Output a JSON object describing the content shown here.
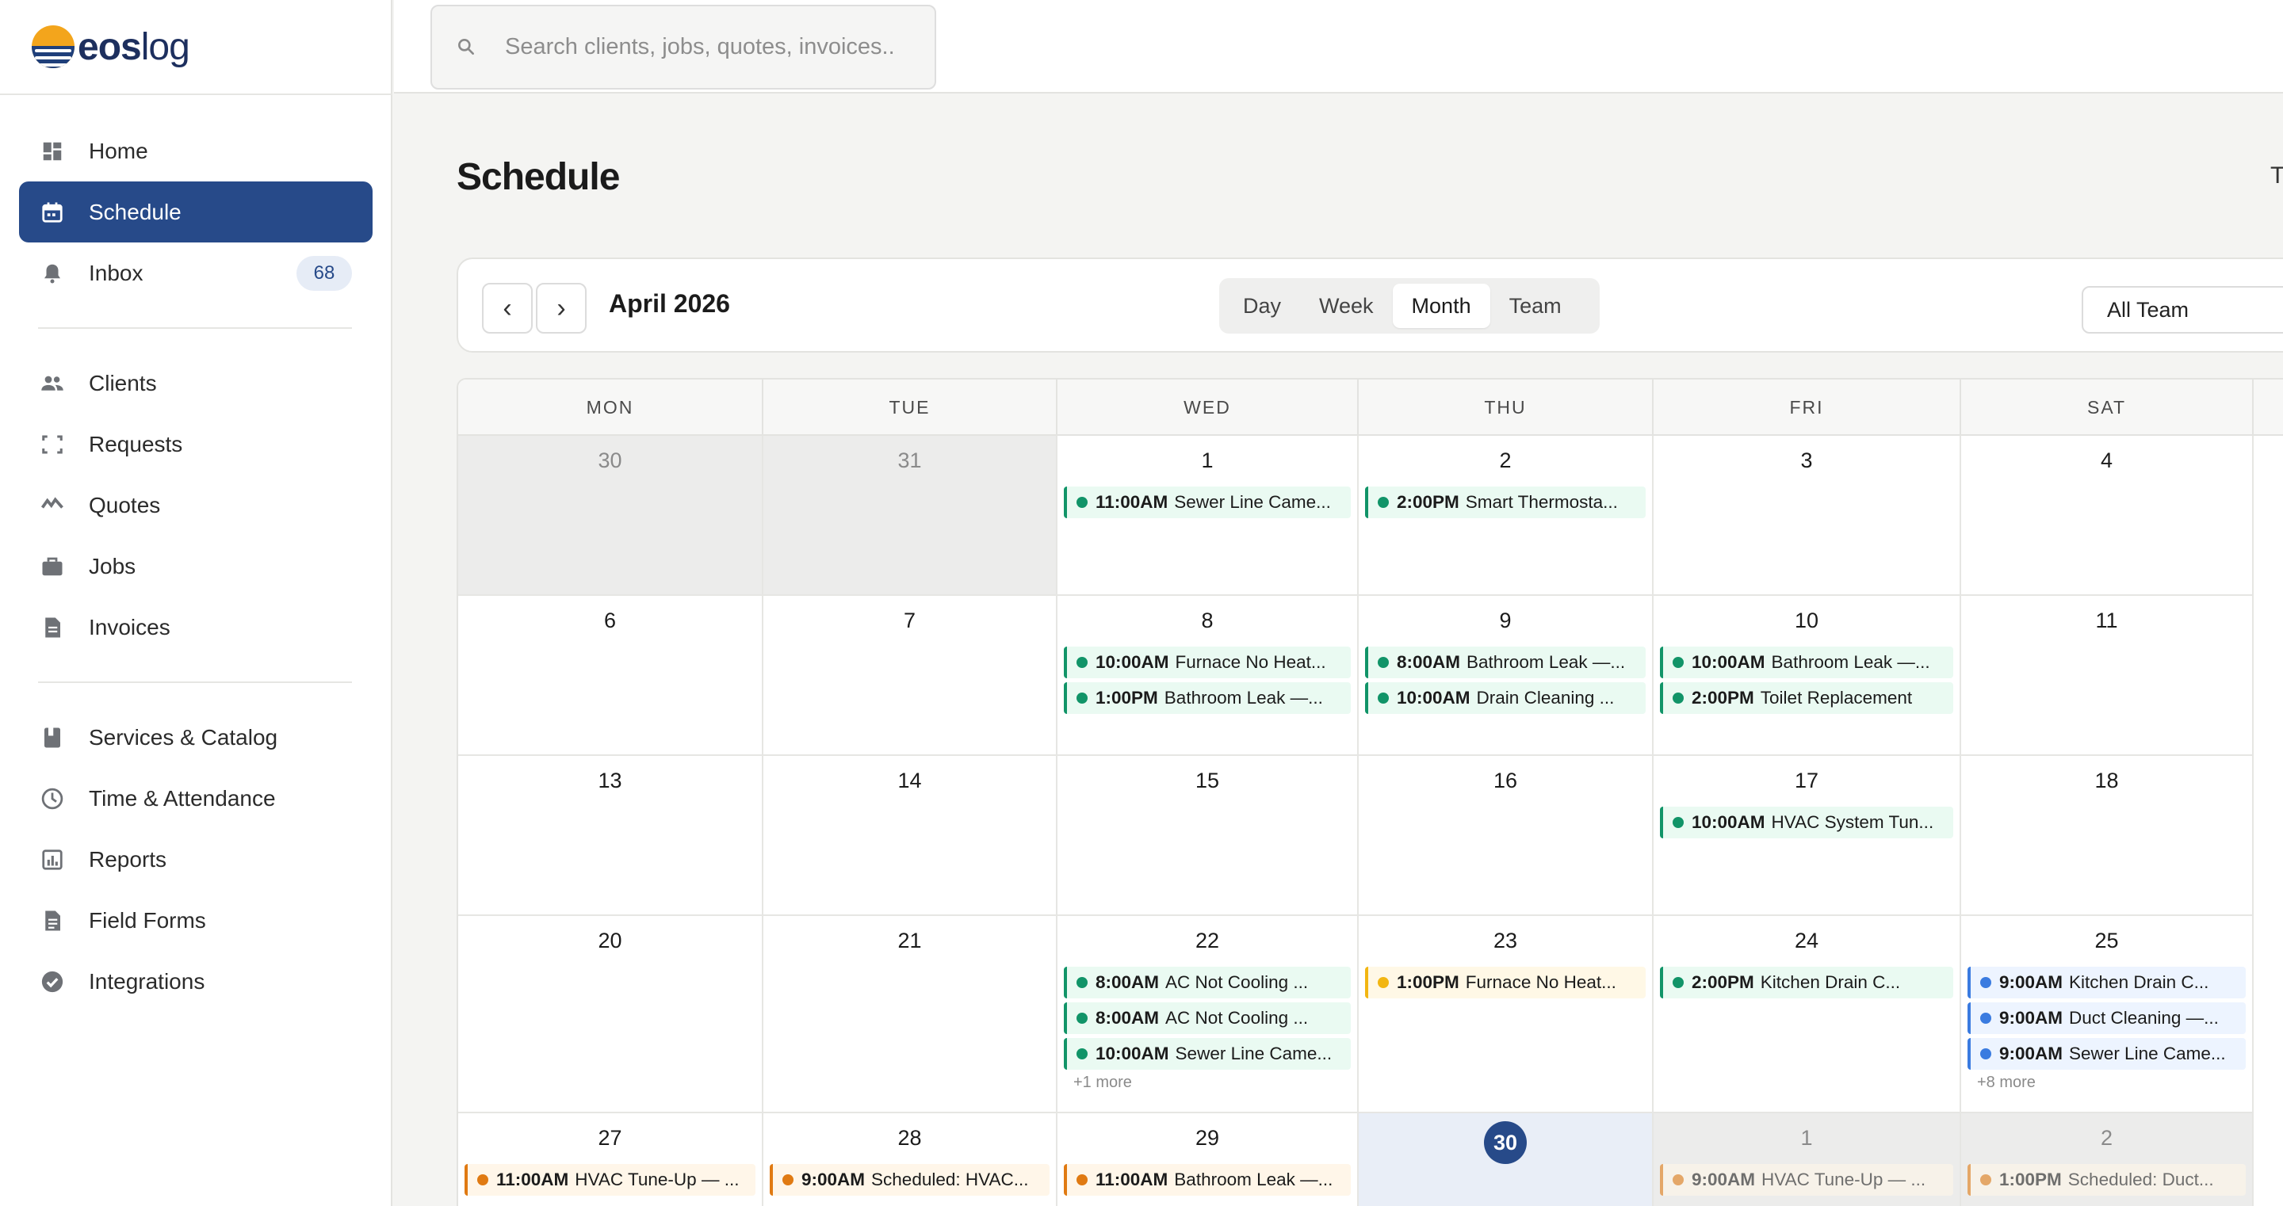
{
  "brand": {
    "name": "eoslog"
  },
  "search": {
    "placeholder": "Search clients, jobs, quotes, invoices.."
  },
  "sidebar": {
    "group1": [
      {
        "label": "Home",
        "icon": "dashboard-icon",
        "active": false
      },
      {
        "label": "Schedule",
        "icon": "calendar-icon",
        "active": true
      },
      {
        "label": "Inbox",
        "icon": "bell-icon",
        "active": false,
        "badge": "68"
      }
    ],
    "group2": [
      {
        "label": "Clients",
        "icon": "people-icon"
      },
      {
        "label": "Requests",
        "icon": "request-icon"
      },
      {
        "label": "Quotes",
        "icon": "quotes-icon"
      },
      {
        "label": "Jobs",
        "icon": "briefcase-icon"
      },
      {
        "label": "Invoices",
        "icon": "document-icon"
      }
    ],
    "group3": [
      {
        "label": "Services & Catalog",
        "icon": "book-icon"
      },
      {
        "label": "Time & Attendance",
        "icon": "clock-icon"
      },
      {
        "label": "Reports",
        "icon": "chart-icon"
      },
      {
        "label": "Field Forms",
        "icon": "form-icon"
      },
      {
        "label": "Integrations",
        "icon": "check-circle-icon"
      }
    ]
  },
  "page": {
    "title": "Schedule",
    "right_truncated": "T"
  },
  "toolbar": {
    "prev_label": "‹",
    "next_label": "›",
    "month_label": "April 2026",
    "views": [
      "Day",
      "Week",
      "Month",
      "Team"
    ],
    "selected_view": "Month",
    "team_filter": "All Team"
  },
  "calendar": {
    "weekdays": [
      "MON",
      "TUE",
      "WED",
      "THU",
      "FRI",
      "SAT"
    ],
    "weeks": [
      [
        {
          "day": "30",
          "muted": true,
          "events": []
        },
        {
          "day": "31",
          "muted": true,
          "events": []
        },
        {
          "day": "1",
          "events": [
            {
              "time": "11:00AM",
              "title": "Sewer Line Came...",
              "color": "green"
            }
          ]
        },
        {
          "day": "2",
          "events": [
            {
              "time": "2:00PM",
              "title": "Smart Thermosta...",
              "color": "green"
            }
          ]
        },
        {
          "day": "3",
          "events": []
        },
        {
          "day": "4",
          "events": []
        }
      ],
      [
        {
          "day": "6",
          "events": []
        },
        {
          "day": "7",
          "events": []
        },
        {
          "day": "8",
          "events": [
            {
              "time": "10:00AM",
              "title": "Furnace No Heat...",
              "color": "green"
            },
            {
              "time": "1:00PM",
              "title": "Bathroom Leak —...",
              "color": "green"
            }
          ]
        },
        {
          "day": "9",
          "events": [
            {
              "time": "8:00AM",
              "title": "Bathroom Leak —...",
              "color": "green"
            },
            {
              "time": "10:00AM",
              "title": "Drain Cleaning ...",
              "color": "green"
            }
          ]
        },
        {
          "day": "10",
          "events": [
            {
              "time": "10:00AM",
              "title": "Bathroom Leak —...",
              "color": "green"
            },
            {
              "time": "2:00PM",
              "title": "Toilet Replacement",
              "color": "green"
            }
          ]
        },
        {
          "day": "11",
          "events": []
        }
      ],
      [
        {
          "day": "13",
          "events": []
        },
        {
          "day": "14",
          "events": []
        },
        {
          "day": "15",
          "events": []
        },
        {
          "day": "16",
          "events": []
        },
        {
          "day": "17",
          "events": [
            {
              "time": "10:00AM",
              "title": "HVAC System Tun...",
              "color": "green"
            }
          ]
        },
        {
          "day": "18",
          "events": []
        }
      ],
      [
        {
          "day": "20",
          "events": []
        },
        {
          "day": "21",
          "events": []
        },
        {
          "day": "22",
          "events": [
            {
              "time": "8:00AM",
              "title": "AC Not Cooling ...",
              "color": "green"
            },
            {
              "time": "8:00AM",
              "title": "AC Not Cooling ...",
              "color": "green"
            },
            {
              "time": "10:00AM",
              "title": "Sewer Line Came...",
              "color": "green"
            }
          ],
          "more": "+1 more"
        },
        {
          "day": "23",
          "events": [
            {
              "time": "1:00PM",
              "title": "Furnace No Heat...",
              "color": "yellow"
            }
          ]
        },
        {
          "day": "24",
          "events": [
            {
              "time": "2:00PM",
              "title": "Kitchen Drain C...",
              "color": "green"
            }
          ]
        },
        {
          "day": "25",
          "events": [
            {
              "time": "9:00AM",
              "title": "Kitchen Drain C...",
              "color": "blue"
            },
            {
              "time": "9:00AM",
              "title": "Duct Cleaning —...",
              "color": "blue"
            },
            {
              "time": "9:00AM",
              "title": "Sewer Line Came...",
              "color": "blue"
            }
          ],
          "more": "+8 more"
        }
      ],
      [
        {
          "day": "27",
          "events": [
            {
              "time": "11:00AM",
              "title": "HVAC Tune-Up — ...",
              "color": "orange"
            }
          ]
        },
        {
          "day": "28",
          "events": [
            {
              "time": "9:00AM",
              "title": "Scheduled: HVAC...",
              "color": "orange"
            }
          ]
        },
        {
          "day": "29",
          "events": [
            {
              "time": "11:00AM",
              "title": "Bathroom Leak —...",
              "color": "orange"
            }
          ]
        },
        {
          "day": "30",
          "today": true,
          "events": []
        },
        {
          "day": "1",
          "muted": true,
          "events": [
            {
              "time": "9:00AM",
              "title": "HVAC Tune-Up — ...",
              "color": "orange"
            }
          ]
        },
        {
          "day": "2",
          "muted": true,
          "events": [
            {
              "time": "1:00PM",
              "title": "Scheduled: Duct...",
              "color": "orange"
            }
          ]
        }
      ]
    ]
  },
  "colors": {
    "accent": "#274a89",
    "green": "#119468",
    "yellow": "#f2b612",
    "blue": "#3a7be0",
    "orange": "#e07a12"
  }
}
